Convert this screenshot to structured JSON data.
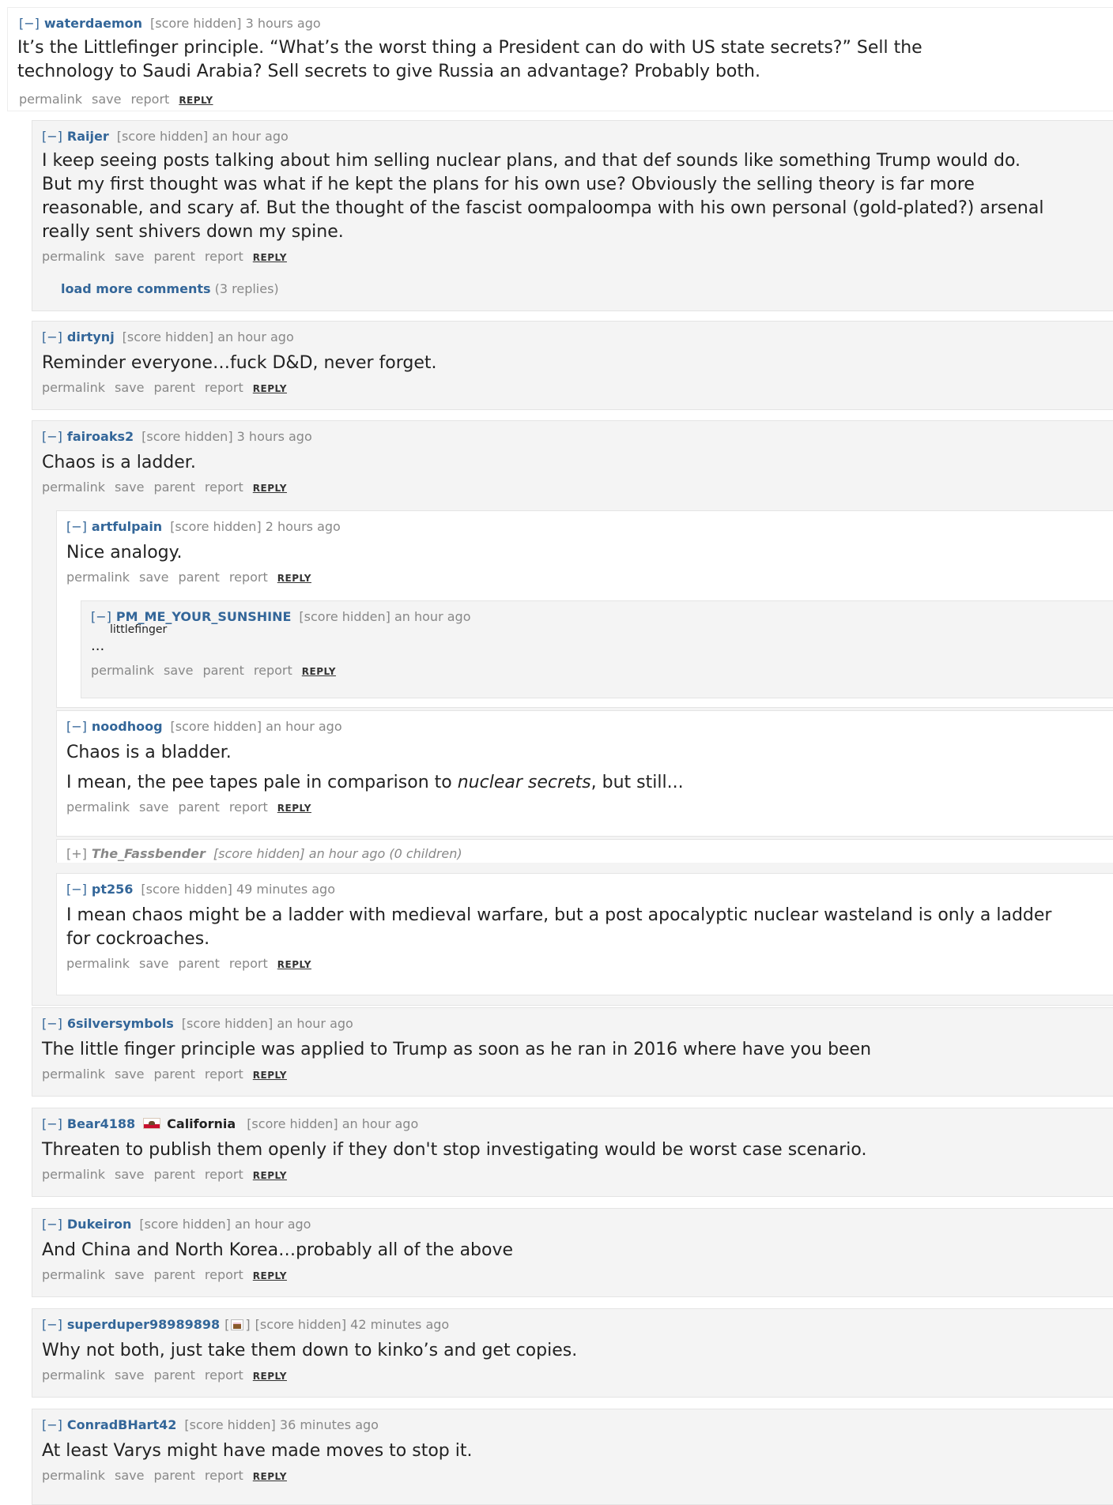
{
  "actions": {
    "permalink": "permalink",
    "save": "save",
    "parent": "parent",
    "report": "report",
    "reply": "REPLY"
  },
  "toggle_expanded": "[−]",
  "toggle_collapsed": "[+]",
  "score_hidden": "[score hidden]",
  "comments": {
    "waterdaemon": {
      "author": "waterdaemon",
      "time": "3 hours ago",
      "body": "It’s the Littlefinger principle. “What’s the worst thing a President can do with US state secrets?” Sell the technology to Saudi Arabia? Sell secrets to give Russia an advantage? Probably both."
    },
    "raijer": {
      "author": "Raijer",
      "time": "an hour ago",
      "body": "I keep seeing posts talking about him selling nuclear plans, and that def sounds like something Trump would do. But my first thought was what if he kept the plans for his own use? Obviously the selling theory is far more reasonable, and scary af. But the thought of the fascist oompaloompa with his own personal (gold-plated?) arsenal really sent shivers down my spine.",
      "load_more_label": "load more comments",
      "load_more_count": "(3 replies)"
    },
    "dirtynj": {
      "author": "dirtynj",
      "time": "an hour ago",
      "body": "Reminder everyone…fuck D&D, never forget."
    },
    "fairoaks2": {
      "author": "fairoaks2",
      "time": "3 hours ago",
      "body": "Chaos is a ladder."
    },
    "artfulpain": {
      "author": "artfulpain",
      "time": "2 hours ago",
      "body": "Nice analogy."
    },
    "sunshine": {
      "author": "PM_ME_YOUR_SUNSHINE",
      "time": "an hour ago",
      "flair": "littlefinger",
      "body": "..."
    },
    "noodhoog": {
      "author": "noodhoog",
      "time": "an hour ago",
      "body_1": "Chaos is a bladder.",
      "body_2_pre": "I mean, the pee tapes pale in comparison to ",
      "body_2_em": "nuclear secrets",
      "body_2_post": ", but still..."
    },
    "fassbender": {
      "author": "The_Fassbender",
      "meta": "[score hidden] an hour ago (0 children)"
    },
    "pt256": {
      "author": "pt256",
      "time": "49 minutes ago",
      "body": "I mean chaos might be a ladder with medieval warfare, but a post apocalyptic nuclear wasteland is only a ladder for cockroaches."
    },
    "silversymbols": {
      "author": "6silversymbols",
      "time": "an hour ago",
      "body": "The little finger principle was applied to Trump as soon as he ran in 2016 where have you been"
    },
    "bear4188": {
      "author": "Bear4188",
      "flair": "California",
      "flair_icon": "california-flag-icon",
      "time": "an hour ago",
      "body": "Threaten to publish them openly if they don't stop investigating would be worst case scenario."
    },
    "dukeiron": {
      "author": "Dukeiron",
      "time": "an hour ago",
      "body": "And China and North Korea…probably all of the above"
    },
    "superduper": {
      "author": "superduper98989898",
      "badge_icon": "cake-icon",
      "time": "42 minutes ago",
      "body": "Why not both, just take them down to kinko’s and get copies."
    },
    "conrad": {
      "author": "ConradBHart42",
      "time": "36 minutes ago",
      "body": "At least Varys might have made moves to stop it."
    }
  }
}
